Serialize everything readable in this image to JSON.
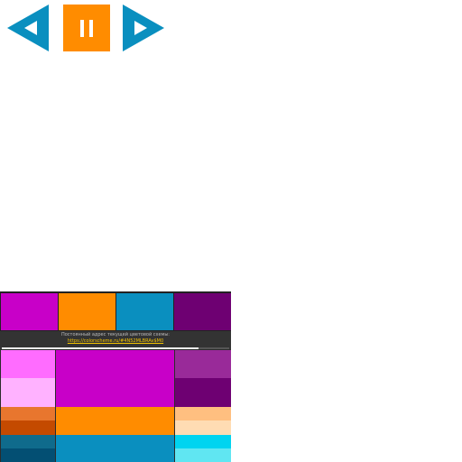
{
  "controls": {
    "prev_icon": "triangle-left-icon",
    "pause_icon": "pause-icon",
    "next_icon": "triangle-right-icon",
    "colors": {
      "blue": "#0a8fbf",
      "orange": "#ff8c00",
      "white": "#ffffff"
    }
  },
  "scheme": {
    "label": "Постоянный адрес текущей цветовой схемы:",
    "link": "https://colorscheme.ru/#4N52MLBRAv$M0",
    "base_colors": [
      "#c800c8",
      "#ff8c00",
      "#0a8fbf",
      "#6e0072"
    ],
    "palette": {
      "magenta": [
        "#ff6cff",
        "#ffb2ff",
        "#c800c8",
        "#992a99",
        "#6e0072"
      ],
      "orange": [
        "#e8762e",
        "#c44a00",
        "#ff8c00",
        "#ffbf80",
        "#ffdcb3"
      ],
      "blue": [
        "#0f6b8c",
        "#034f73",
        "#0a8fbf",
        "#00d4f0",
        "#60e6f2"
      ]
    }
  }
}
